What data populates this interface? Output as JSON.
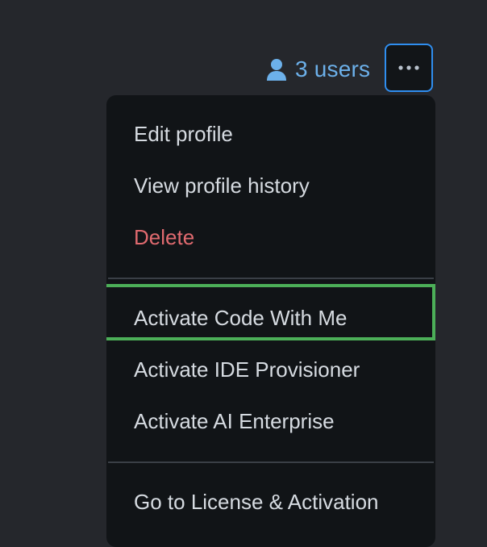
{
  "header": {
    "users_label": "3 users",
    "users_icon": "user-icon",
    "more_button_icon": "ellipsis-icon"
  },
  "menu": {
    "items": [
      {
        "label": "Edit profile"
      },
      {
        "label": "View profile history"
      },
      {
        "label": "Delete",
        "tone": "danger"
      },
      {
        "label": "Activate Code With Me",
        "highlighted": true
      },
      {
        "label": "Activate IDE Provisioner"
      },
      {
        "label": "Activate AI Enterprise"
      },
      {
        "label": "Go to License & Activation"
      }
    ]
  },
  "colors": {
    "background": "#25272c",
    "menu_background": "#111417",
    "link": "#6cb0ea",
    "danger": "#e06a6f",
    "focus_border": "#2f8ef0",
    "highlight": "#4caf58"
  }
}
